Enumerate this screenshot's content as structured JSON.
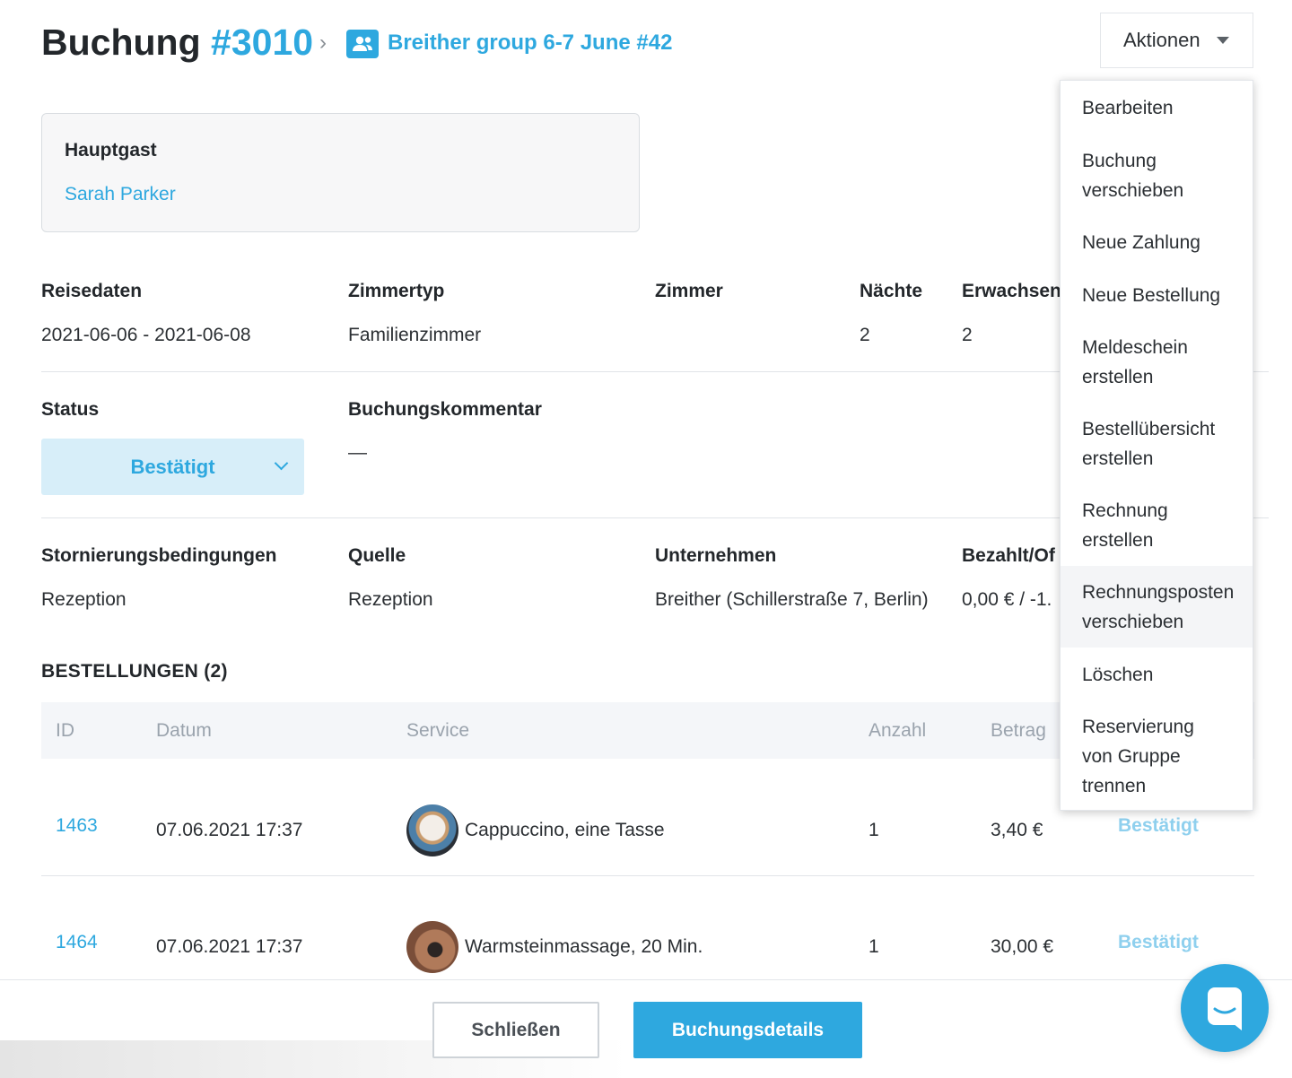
{
  "header": {
    "title_prefix": "Buchung ",
    "title_number": "#3010",
    "group_link": "Breither group 6-7 June #42",
    "actions_label": "Aktionen"
  },
  "guest": {
    "label": "Hauptgast",
    "name": "Sarah Parker"
  },
  "details_row1": {
    "travel_dates_label": "Reisedaten",
    "travel_dates_value": "2021-06-06 - 2021-06-08",
    "room_type_label": "Zimmertyp",
    "room_type_value": "Familienzimmer",
    "room_label": "Zimmer",
    "nights_label": "Nächte",
    "nights_value": "2",
    "adults_label": "Erwachsen",
    "adults_value": "2"
  },
  "details_row2": {
    "status_label": "Status",
    "status_value": "Bestätigt",
    "comment_label": "Buchungskommentar",
    "comment_value": "—"
  },
  "details_row3": {
    "cancellation_label": "Stornierungsbedingungen",
    "cancellation_value": "Rezeption",
    "source_label": "Quelle",
    "source_value": "Rezeption",
    "company_label": "Unternehmen",
    "company_value": "Breither (Schillerstraße 7, Berlin)",
    "paid_label": "Bezahlt/Of",
    "paid_value": "0,00 € / -1."
  },
  "orders": {
    "title": "BESTELLUNGEN (2)",
    "columns": [
      "ID",
      "Datum",
      "Service",
      "Anzahl",
      "Betrag"
    ],
    "rows": [
      {
        "id": "1463",
        "date": "07.06.2021 17:37",
        "service": "Cappuccino, eine Tasse",
        "qty": "1",
        "amount": "3,40 €",
        "status": "Bestätigt"
      },
      {
        "id": "1464",
        "date": "07.06.2021 17:37",
        "service": "Warmsteinmassage, 20 Min.",
        "qty": "1",
        "amount": "30,00 €",
        "status": "Bestätigt"
      }
    ]
  },
  "menu": {
    "items": [
      "Bearbeiten",
      "Buchung verschieben",
      "Neue Zahlung",
      "Neue Bestellung",
      "Meldeschein erstellen",
      "Bestellübersicht erstellen",
      "Rechnung erstellen",
      "Rechnungsposten verschieben",
      "Löschen",
      "Reservierung von Gruppe trennen"
    ]
  },
  "footer": {
    "close_label": "Schließen",
    "details_label": "Buchungsdetails"
  },
  "colors": {
    "accent": "#2ea8df",
    "status_bg": "#d7eef9"
  },
  "icons": {
    "group": "group-users-icon",
    "breadcrumb": "chevron-right-icon",
    "caret": "caret-down-icon",
    "chat": "chat-icon"
  }
}
